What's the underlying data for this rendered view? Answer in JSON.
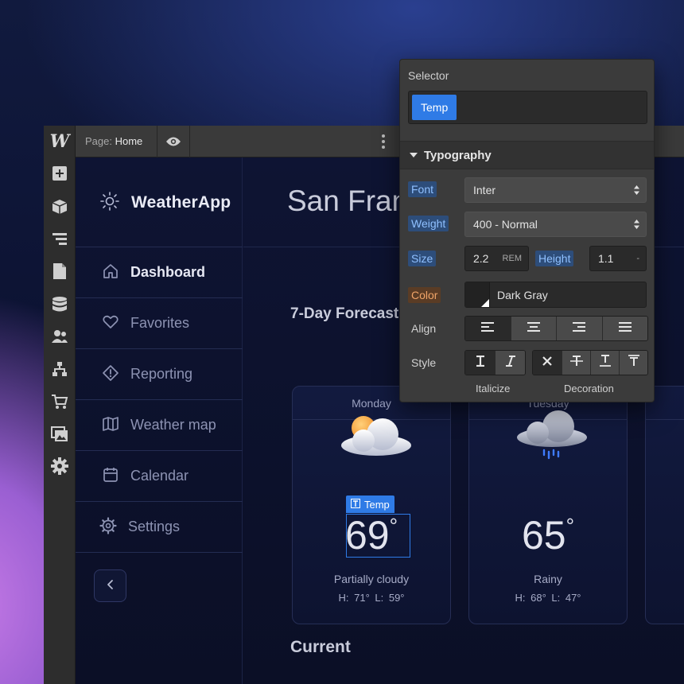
{
  "editor": {
    "logo": "W",
    "page_label_key": "Page:",
    "page_label_value": "Home",
    "left_toolbar_icons": [
      "add-icon",
      "components-icon",
      "navigator-icon",
      "pages-icon",
      "cms-icon",
      "users-icon",
      "logic-icon",
      "ecommerce-icon",
      "assets-icon",
      "settings-icon"
    ]
  },
  "app": {
    "brand": "WeatherApp",
    "nav": [
      {
        "label": "Dashboard",
        "icon": "home-icon",
        "active": true
      },
      {
        "label": "Favorites",
        "icon": "heart-icon",
        "active": false
      },
      {
        "label": "Reporting",
        "icon": "alert-icon",
        "active": false
      },
      {
        "label": "Weather map",
        "icon": "map-icon",
        "active": false
      },
      {
        "label": "Calendar",
        "icon": "calendar-icon",
        "active": false
      },
      {
        "label": "Settings",
        "icon": "gear-icon",
        "active": false
      }
    ],
    "city": "San Francisco",
    "forecast_title": "7-Day Forecast",
    "current_title": "Current",
    "cards": [
      {
        "day": "Monday",
        "temp": "69",
        "condition": "Partially cloudy",
        "hilo": "H: 71°  L: 59°",
        "icon": "partly-cloudy-icon"
      },
      {
        "day": "Tuesday",
        "temp": "65",
        "condition": "Rainy",
        "hilo": "H: 68°  L: 47°",
        "icon": "rain-cloud-icon"
      }
    ],
    "degree": "°",
    "selected_tag": "Temp"
  },
  "panel": {
    "selector_label": "Selector",
    "selector_chip": "Temp",
    "section": "Typography",
    "font_label": "Font",
    "font_value": "Inter",
    "weight_label": "Weight",
    "weight_value": "400 - Normal",
    "size_label": "Size",
    "size_value": "2.2",
    "size_unit": "REM",
    "height_label": "Height",
    "height_value": "1.1",
    "height_unit": "-",
    "color_label": "Color",
    "color_value": "Dark Gray",
    "align_label": "Align",
    "style_label": "Style",
    "italicize_caption": "Italicize",
    "decoration_caption": "Decoration"
  },
  "colors": {
    "accent": "#2f7be6",
    "panel_bg": "#3b3b3b",
    "canvas_bg": "#0e1433"
  }
}
